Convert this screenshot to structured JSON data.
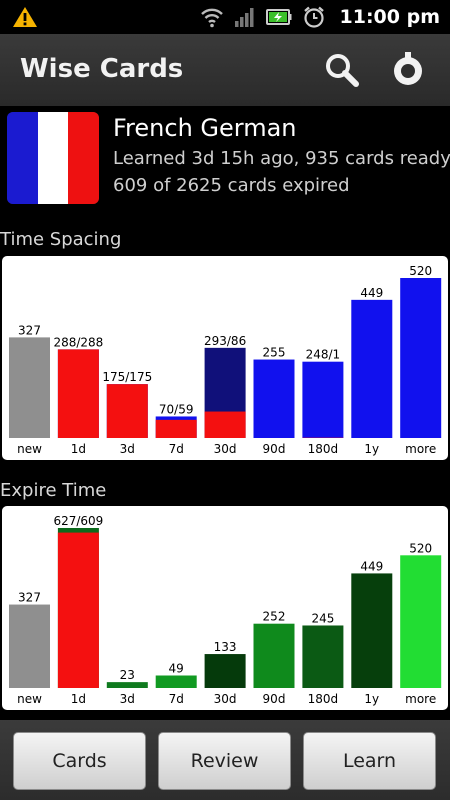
{
  "status_bar": {
    "time": "11:00 pm",
    "icons": [
      "warning-icon",
      "wifi-icon",
      "signal-icon",
      "battery-charging-icon",
      "alarm-clock-icon"
    ]
  },
  "app_bar": {
    "title": "Wise Cards",
    "icons": [
      "search-icon",
      "settings-icon"
    ]
  },
  "deck": {
    "name": "French German",
    "line1": "Learned 3d 15h ago, 935 cards ready",
    "line2": "609 of 2625 cards expired",
    "flag_colors": [
      "#1b1bd0",
      "#ffffff",
      "#ee1111"
    ]
  },
  "sections": {
    "time_spacing": "Time Spacing",
    "expire_time": "Expire Time"
  },
  "chart_data": [
    {
      "type": "bar",
      "title": "Time Spacing",
      "categories": [
        "new",
        "1d",
        "3d",
        "7d",
        "30d",
        "90d",
        "180d",
        "1y",
        "more"
      ],
      "labels": [
        "327",
        "288/288",
        "175/175",
        "70/59",
        "293/86",
        "255",
        "248/1",
        "449",
        "520"
      ],
      "series": [
        {
          "values": [
            327,
            288,
            175,
            70,
            293,
            255,
            248,
            449,
            520
          ]
        },
        {
          "values": [
            0,
            288,
            175,
            59,
            86,
            0,
            1,
            0,
            0
          ]
        }
      ],
      "colors": {
        "new": "#8f8f8f",
        "bar": "#1111ee",
        "bar_30d": "#10107a",
        "expired": "#f41010"
      },
      "ylim": [
        0,
        520
      ]
    },
    {
      "type": "bar",
      "title": "Expire Time",
      "categories": [
        "new",
        "1d",
        "3d",
        "7d",
        "30d",
        "90d",
        "180d",
        "1y",
        "more"
      ],
      "labels": [
        "327",
        "627/609",
        "23",
        "49",
        "133",
        "252",
        "245",
        "449",
        "520"
      ],
      "series": [
        {
          "values": [
            327,
            627,
            23,
            49,
            133,
            252,
            245,
            449,
            520
          ]
        },
        {
          "values": [
            0,
            609,
            0,
            0,
            0,
            0,
            0,
            0,
            0
          ]
        }
      ],
      "colors": {
        "new": "#8f8f8f",
        "expired": "#f41010",
        "greens": [
          "#8f8f8f",
          "#0c6a1c",
          "#0f7a1e",
          "#119a22",
          "#053a0b",
          "#0f8a1c",
          "#0b5a14",
          "#063f0c",
          "#22dd33"
        ]
      },
      "ylim": [
        0,
        627
      ]
    }
  ],
  "bottom_bar": {
    "cards": "Cards",
    "review": "Review",
    "learn": "Learn"
  }
}
